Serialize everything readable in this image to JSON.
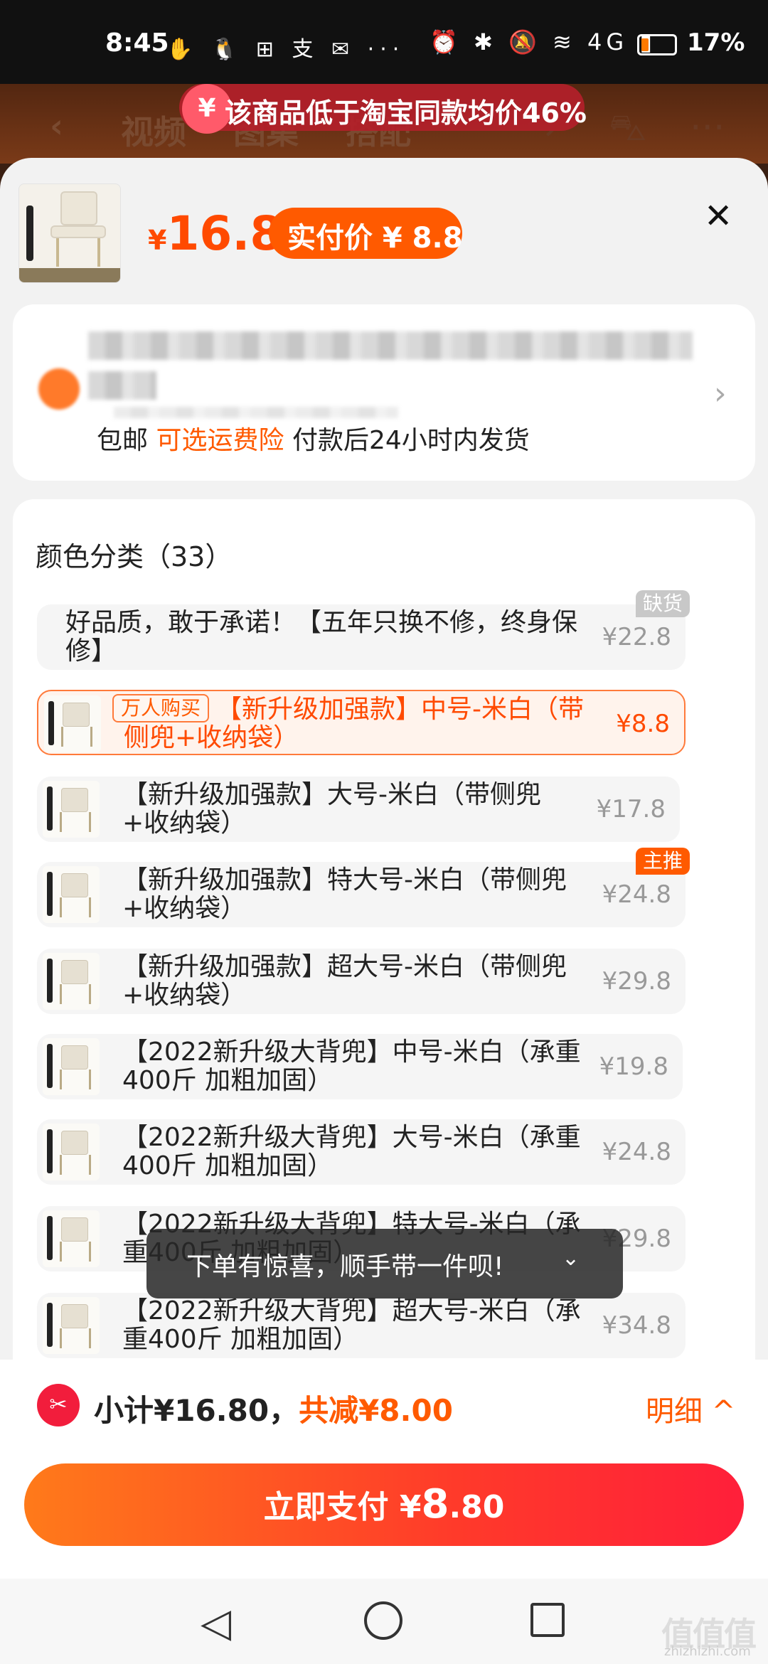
{
  "status_bar": {
    "time": "8:45",
    "app_icons": "✋ 🐧 ⊞ 支 ✉ ···",
    "system_icons": "⏰ ✱ 🔕 ≋ 4G ▮",
    "battery": "17%"
  },
  "background_page": {
    "price_banner_icon": "¥",
    "price_banner": "该商品低于淘宝同款均价46%",
    "nav_items": [
      "视频",
      "图集",
      "搭配"
    ]
  },
  "product": {
    "price_symbol": "¥",
    "price": "16.8",
    "actual_price_label": "实付价 ¥ 8.8",
    "close": "✕"
  },
  "shipping": {
    "free_shipping": "包邮",
    "insurance_link": "可选运费险",
    "dispatch": "付款后24小时内发货"
  },
  "options": {
    "title": "颜色分类（33）",
    "items": [
      {
        "name": "好品质，敢于承诺！【五年只换不修，终身保修】",
        "price": "¥22.8",
        "corner_badge": "缺货"
      },
      {
        "name": "【新升级加强款】中号-米白（带侧兜+收纳袋）",
        "price": "¥8.8",
        "tag": "万人购买"
      },
      {
        "name": "【新升级加强款】大号-米白（带侧兜+收纳袋）",
        "price": "¥17.8"
      },
      {
        "name": "【新升级加强款】特大号-米白（带侧兜+收纳袋）",
        "price": "¥24.8",
        "corner_badge": "主推"
      },
      {
        "name": "【新升级加强款】超大号-米白（带侧兜+收纳袋）",
        "price": "¥29.8"
      },
      {
        "name": "【2022新升级大背兜】中号-米白（承重400斤 加粗加固）",
        "price": "¥19.8"
      },
      {
        "name": "【2022新升级大背兜】大号-米白（承重400斤 加粗加固）",
        "price": "¥24.8"
      },
      {
        "name": "【2022新升级大背兜】特大号-米白（承重400斤 加粗加固）",
        "price": "¥29.8"
      },
      {
        "name": "【2022新升级大背兜】超大号-米白（承重400斤 加粗加固）",
        "price": "¥34.8"
      }
    ]
  },
  "toast": {
    "text": "下单有惊喜，顺手带一件呗!",
    "icon": "⌄"
  },
  "footer": {
    "subtotal": "小计¥16.80，",
    "discount": "共减¥8.00",
    "detail": "明细 ^",
    "pay_label": "立即支付 ¥",
    "pay_amount_int": "8",
    "pay_amount_dec": ".80"
  },
  "watermark": {
    "logo": "值值值",
    "site": "zhizhizhi.com"
  },
  "colors": {
    "accent": "#ff5a00",
    "pay_gradient_start": "#ff7a1a",
    "pay_gradient_end": "#ff1f3a",
    "out_of_stock_badge": "#cccccc",
    "featured_badge": "#ff5a00"
  }
}
